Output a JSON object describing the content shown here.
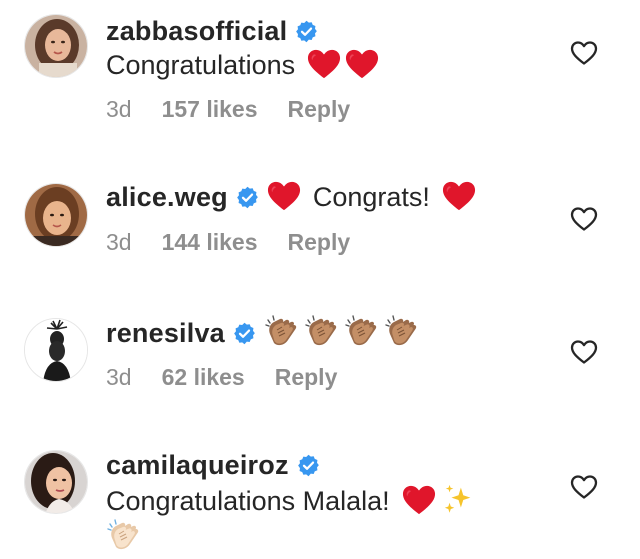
{
  "colors": {
    "text": "#262626",
    "secondary": "#8e8e8e",
    "verified": "#3897f0",
    "heart_emoji": "#e0162b"
  },
  "comments": [
    {
      "username": "zabbasofficial",
      "verified": true,
      "text": "Congratulations",
      "emojis": [
        "red-heart",
        "red-heart"
      ],
      "time": "3d",
      "likes": "157 likes",
      "reply": "Reply"
    },
    {
      "username": "alice.weg",
      "verified": true,
      "text": "Congrats!",
      "emojis": [
        "red-heart",
        "red-heart"
      ],
      "time": "3d",
      "likes": "144 likes",
      "reply": "Reply"
    },
    {
      "username": "renesilva",
      "verified": true,
      "text": "",
      "emojis": [
        "clapping-hands",
        "clapping-hands",
        "clapping-hands",
        "clapping-hands"
      ],
      "time": "3d",
      "likes": "62 likes",
      "reply": "Reply"
    },
    {
      "username": "camilaqueiroz",
      "verified": true,
      "text": "Congratulations Malala!",
      "emojis": [
        "red-heart",
        "sparkles",
        "clapping-hands-light"
      ]
    }
  ]
}
